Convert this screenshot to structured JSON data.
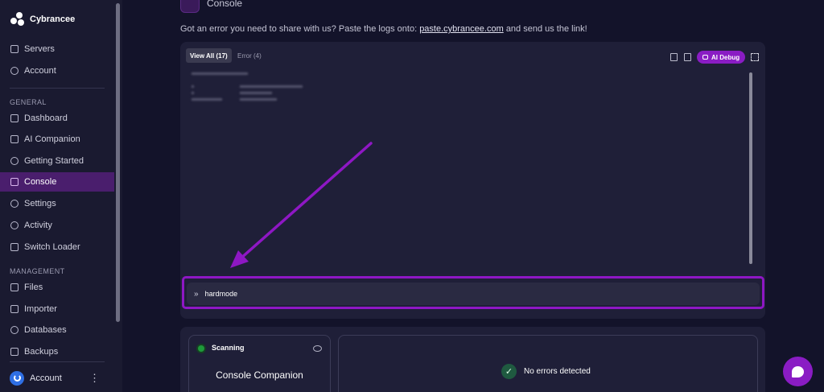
{
  "brand": {
    "name": "Cybrancee"
  },
  "sidebar": {
    "top_items": [
      {
        "label": "Servers",
        "icon": "server-icon"
      },
      {
        "label": "Account",
        "icon": "user-icon"
      }
    ],
    "general_label": "GENERAL",
    "general_items": [
      {
        "label": "Dashboard",
        "icon": "dashboard-icon"
      },
      {
        "label": "AI Companion",
        "icon": "bot-icon"
      },
      {
        "label": "Getting Started",
        "icon": "lifebuoy-icon"
      },
      {
        "label": "Console",
        "icon": "terminal-icon",
        "active": true
      },
      {
        "label": "Settings",
        "icon": "gear-icon"
      },
      {
        "label": "Activity",
        "icon": "eye-icon"
      },
      {
        "label": "Switch Loader",
        "icon": "swap-icon"
      }
    ],
    "management_label": "MANAGEMENT",
    "management_items": [
      {
        "label": "Files",
        "icon": "folder-icon"
      },
      {
        "label": "Importer",
        "icon": "download-icon"
      },
      {
        "label": "Databases",
        "icon": "database-icon"
      },
      {
        "label": "Backups",
        "icon": "archive-icon"
      }
    ],
    "account_label": "Account"
  },
  "page": {
    "title": "Console",
    "notice_prefix": "Got an error you need to share with us? Paste the logs onto:",
    "notice_link": "paste.cybrancee.com",
    "notice_suffix": "and send us the link!"
  },
  "console": {
    "tabs": [
      {
        "label": "View All (17)",
        "active": true
      },
      {
        "label": "Error (4)",
        "active": false
      }
    ],
    "ai_debug_label": "AI Debug",
    "command_value": "hardmode"
  },
  "companion": {
    "status": "Scanning",
    "title": "Console Companion",
    "result": "No errors detected"
  },
  "colors": {
    "accent": "#8a1cc4",
    "active_nav": "#4a1e6d",
    "background": "#13132a",
    "status_ok": "#1e9a3a"
  }
}
